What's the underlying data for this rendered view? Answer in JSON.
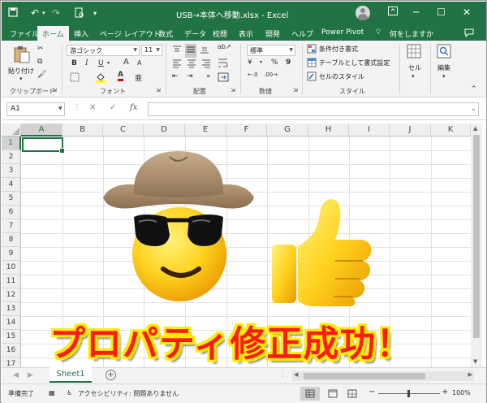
{
  "window": {
    "title": "USB→本体へ移動.xlsx  -  Excel"
  },
  "tabs": [
    "ファイル",
    "ホーム",
    "挿入",
    "ページ レイアウト",
    "数式",
    "データ",
    "校閲",
    "表示",
    "開発",
    "ヘルプ",
    "Power Pivot"
  ],
  "search_tab": "何をしますか",
  "ribbon": {
    "paste": "貼り付け",
    "clipboard": "クリップボード",
    "font_name": "游ゴシック",
    "font_size": "11",
    "font_group": "フォント",
    "bold": "B",
    "italic": "I",
    "underline": "U",
    "grow": "A",
    "shrink": "A",
    "font_color": "A",
    "alignment": "配置",
    "number_format": "標準",
    "percent": "%",
    "comma": "9",
    "currency": "¥",
    "number": "数値",
    "conditional": "条件付き書式",
    "table_format": "テーブルとして書式設定",
    "cell_style": "セルのスタイル",
    "styles": "スタイル",
    "cell": "セル",
    "edit": "編集"
  },
  "formula_bar": {
    "name_box": "A1",
    "fx": "fx",
    "value": ""
  },
  "columns": [
    "A",
    "B",
    "C",
    "D",
    "E",
    "F",
    "G",
    "H",
    "I",
    "J",
    "K"
  ],
  "rows": [
    "1",
    "2",
    "3",
    "4",
    "5",
    "6",
    "7",
    "8",
    "9",
    "10",
    "11",
    "12",
    "13",
    "14",
    "15",
    "16",
    "17"
  ],
  "overlay": {
    "message": "プロパティ修正成功！"
  },
  "sheets": [
    "Sheet1"
  ],
  "status": {
    "ready": "準備完了",
    "accessibility": "アクセシビリティ: 問題ありません",
    "zoom": "100%"
  },
  "colors": {
    "accent": "#217346",
    "message": "#ff1a1a",
    "message_outline": "#ffeb00"
  }
}
